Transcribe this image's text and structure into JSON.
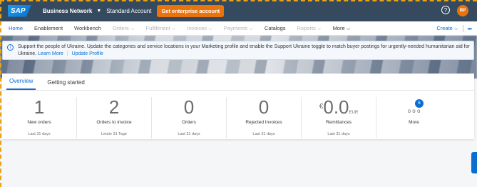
{
  "shellbar": {
    "logo": "SAP",
    "brand": "Business Network",
    "account": "Standard Account",
    "enterprise_button": "Get enterprise account",
    "avatar_initials": "BP"
  },
  "nav": {
    "items": [
      {
        "label": "Home"
      },
      {
        "label": "Enablement"
      },
      {
        "label": "Workbench"
      },
      {
        "label": "Orders ⌵"
      },
      {
        "label": "Fulfillment ⌵"
      },
      {
        "label": "Invoices ⌵"
      },
      {
        "label": "Payments ⌵"
      },
      {
        "label": "Catalogs"
      },
      {
        "label": "Reports ⌵"
      },
      {
        "label": "More ⌵"
      }
    ],
    "create_label": "Create ⌵"
  },
  "message": {
    "text": "Support the people of Ukraine. Update the categories and service locations in your Marketing profile and enable the Support Ukraine toggle to match buyer postings for urgently-needed humanitarian aid for Ukraine.",
    "learn_more": "Learn More",
    "update_profile": "Update Profile"
  },
  "tabs": {
    "overview": "Overview",
    "getting_started": "Getting started"
  },
  "kpis": [
    {
      "value": "1",
      "label": "New orders",
      "period": "Last 31 days"
    },
    {
      "value": "2",
      "label": "Orders to invoice",
      "period": "Letzte 31 Tage"
    },
    {
      "value": "0",
      "label": "Orders",
      "period": "Last 31 days"
    },
    {
      "value": "0",
      "label": "Rejected Invoices",
      "period": "Last 31 days"
    },
    {
      "currency": "€",
      "value": "0.0",
      "unit": "EUR",
      "label": "Remittances",
      "period": "Last 31 days"
    },
    {
      "label": "More",
      "badge": "6"
    }
  ],
  "colors": {
    "shell": "#354a5f",
    "accent": "#0a6ed1",
    "enterprise": "#e9730c"
  }
}
